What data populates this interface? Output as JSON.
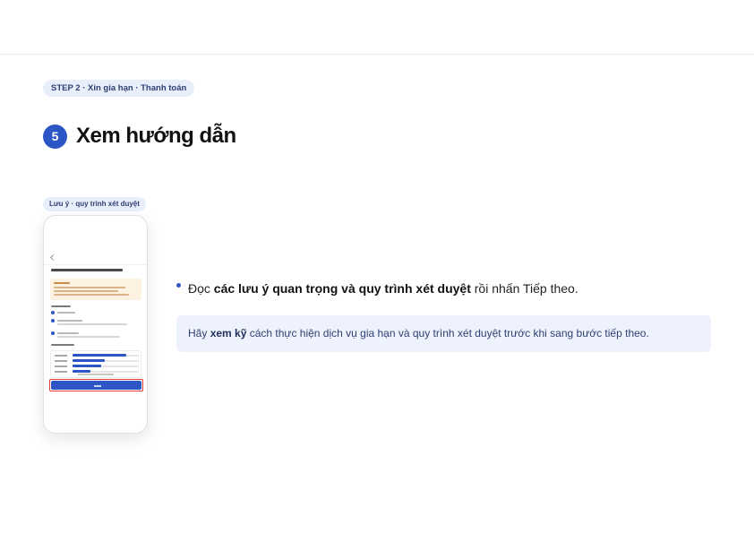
{
  "step": {
    "badge": "STEP 2 · Xin gia hạn · Thanh toán",
    "number": "5",
    "title": "Xem hướng dẫn"
  },
  "phone": {
    "label": "Lưu ý · quy trình xét duyệt"
  },
  "instruction": {
    "prefix": "Đọc ",
    "bold": "các lưu ý quan trọng và quy trình xét duyệt",
    "suffix": " rồi nhấn Tiếp theo."
  },
  "tip": {
    "prefix": "Hãy ",
    "bold": "xem kỹ",
    "suffix": " cách thực hiện dịch vụ gia hạn và quy trình xét duyệt trước khi sang bước tiếp theo."
  },
  "colors": {
    "accent": "#2c55c6",
    "badge_bg": "#e9eefb",
    "tip_bg": "#eef2fc",
    "highlight_border": "#e23a3a"
  }
}
